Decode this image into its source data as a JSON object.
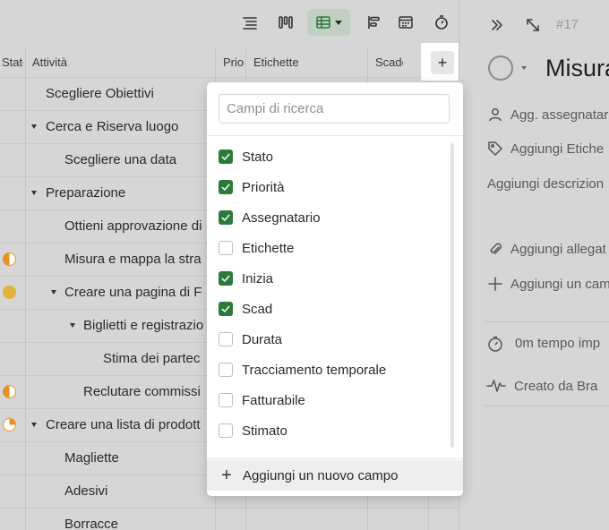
{
  "header": {
    "columns": [
      "Stato",
      "Attività",
      "Priorità",
      "Etichette",
      "Scadenza"
    ]
  },
  "rows": [
    {
      "label": "Scegliere Obiettivi",
      "level": 1,
      "expand": false,
      "status": ""
    },
    {
      "label": "Cerca e Riserva luogo",
      "level": 1,
      "expand": true,
      "status": ""
    },
    {
      "label": "Scegliere una data",
      "level": 2,
      "expand": false,
      "status": ""
    },
    {
      "label": "Preparazione",
      "level": 1,
      "expand": true,
      "status": ""
    },
    {
      "label": "Ottieni approvazione di",
      "level": 2,
      "expand": false,
      "status": ""
    },
    {
      "label": "Misura e mappa la stra",
      "level": 2,
      "expand": false,
      "status": "half-orange"
    },
    {
      "label": "Creare una pagina di F",
      "level": 2,
      "expand": true,
      "status": "yellow"
    },
    {
      "label": "Biglietti e registrazio",
      "level": 3,
      "expand": true,
      "status": ""
    },
    {
      "label": "Stima dei partec",
      "level": 4,
      "expand": false,
      "status": ""
    },
    {
      "label": "Reclutare commissi",
      "level": 3,
      "expand": false,
      "status": "half-orange"
    },
    {
      "label": "Creare una lista di prodott",
      "level": 1,
      "expand": true,
      "status": "quarter-orange"
    },
    {
      "label": "Magliette",
      "level": 2,
      "expand": false,
      "status": ""
    },
    {
      "label": "Adesivi",
      "level": 2,
      "expand": false,
      "status": ""
    },
    {
      "label": "Borracce",
      "level": 2,
      "expand": false,
      "status": ""
    }
  ],
  "dropdown": {
    "search_placeholder": "Campi di ricerca",
    "options": [
      {
        "label": "Stato",
        "checked": true
      },
      {
        "label": "Priorità",
        "checked": true
      },
      {
        "label": "Assegnatario",
        "checked": true
      },
      {
        "label": "Etichette",
        "checked": false
      },
      {
        "label": "Inizia",
        "checked": true
      },
      {
        "label": "Scad",
        "checked": true
      },
      {
        "label": "Durata",
        "checked": false
      },
      {
        "label": "Tracciamento temporale",
        "checked": false
      },
      {
        "label": "Fatturabile",
        "checked": false
      },
      {
        "label": "Stimato",
        "checked": false
      }
    ],
    "add_field_label": "Aggiungi un nuovo campo"
  },
  "right_pane": {
    "task_id": "#17",
    "title": "Misura",
    "assign": "Agg. assegnatar",
    "tags": "Aggiungi Etiche",
    "description": "Aggiungi descrizion",
    "attachments": "Aggiungi allegat",
    "add_field": "Aggiungi un cam",
    "time": "0m tempo imp",
    "created": "Creato da Bra"
  },
  "colors": {
    "accent_green": "#2b7a3a",
    "status_orange": "#e8902a",
    "status_yellow": "#e0b43a"
  }
}
